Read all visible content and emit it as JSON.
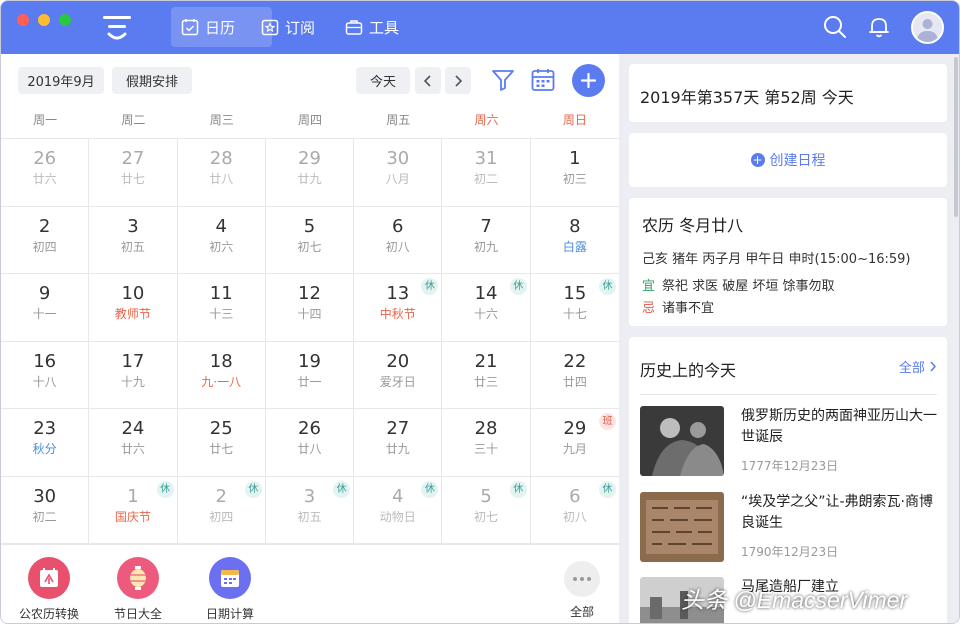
{
  "topbar": {
    "nav": [
      {
        "label": "日历",
        "icon": "calendar-check-icon",
        "active": true
      },
      {
        "label": "订阅",
        "icon": "star-card-icon",
        "active": false
      },
      {
        "label": "工具",
        "icon": "briefcase-icon",
        "active": false
      }
    ],
    "accent": "#5b7cf0"
  },
  "calendar": {
    "month_label": "2019年9月",
    "holiday_label": "假期安排",
    "today_label": "今天",
    "weekdays": [
      "周一",
      "周二",
      "周三",
      "周四",
      "周五",
      "周六",
      "周日"
    ],
    "weeks": [
      [
        {
          "day": "26",
          "sub": "廿六",
          "dim": true
        },
        {
          "day": "27",
          "sub": "廿七",
          "dim": true
        },
        {
          "day": "28",
          "sub": "廿八",
          "dim": true
        },
        {
          "day": "29",
          "sub": "廿九",
          "dim": true
        },
        {
          "day": "30",
          "sub": "八月",
          "dim": true
        },
        {
          "day": "31",
          "sub": "初二",
          "dim": true
        },
        {
          "day": "1",
          "sub": "初三"
        }
      ],
      [
        {
          "day": "2",
          "sub": "初四"
        },
        {
          "day": "3",
          "sub": "初五"
        },
        {
          "day": "4",
          "sub": "初六"
        },
        {
          "day": "5",
          "sub": "初七"
        },
        {
          "day": "6",
          "sub": "初八"
        },
        {
          "day": "7",
          "sub": "初九"
        },
        {
          "day": "8",
          "sub": "白露",
          "tone": "blue"
        }
      ],
      [
        {
          "day": "9",
          "sub": "十一"
        },
        {
          "day": "10",
          "sub": "教师节",
          "tone": "orange"
        },
        {
          "day": "11",
          "sub": "十三"
        },
        {
          "day": "12",
          "sub": "十四"
        },
        {
          "day": "13",
          "sub": "中秋节",
          "tone": "orange",
          "badge": "休"
        },
        {
          "day": "14",
          "sub": "十六",
          "badge": "休"
        },
        {
          "day": "15",
          "sub": "十七",
          "badge": "休"
        }
      ],
      [
        {
          "day": "16",
          "sub": "十八"
        },
        {
          "day": "17",
          "sub": "十九"
        },
        {
          "day": "18",
          "sub": "九·一八",
          "tone": "orange"
        },
        {
          "day": "19",
          "sub": "廿一"
        },
        {
          "day": "20",
          "sub": "爱牙日"
        },
        {
          "day": "21",
          "sub": "廿三"
        },
        {
          "day": "22",
          "sub": "廿四"
        }
      ],
      [
        {
          "day": "23",
          "sub": "秋分",
          "tone": "blue"
        },
        {
          "day": "24",
          "sub": "廿六"
        },
        {
          "day": "25",
          "sub": "廿七"
        },
        {
          "day": "26",
          "sub": "廿八"
        },
        {
          "day": "27",
          "sub": "廿九"
        },
        {
          "day": "28",
          "sub": "三十"
        },
        {
          "day": "29",
          "sub": "九月",
          "badge": "班"
        }
      ],
      [
        {
          "day": "30",
          "sub": "初二"
        },
        {
          "day": "1",
          "sub": "国庆节",
          "tone": "orange",
          "badge": "休",
          "dim": true
        },
        {
          "day": "2",
          "sub": "初四",
          "badge": "休",
          "dim": true
        },
        {
          "day": "3",
          "sub": "初五",
          "badge": "休",
          "dim": true
        },
        {
          "day": "4",
          "sub": "动物日",
          "badge": "休",
          "dim": true
        },
        {
          "day": "5",
          "sub": "初七",
          "badge": "休",
          "dim": true
        },
        {
          "day": "6",
          "sub": "初八",
          "badge": "休",
          "dim": true
        }
      ]
    ]
  },
  "tools": [
    {
      "label": "公农历转换",
      "icon": "nong-convert-icon",
      "color": "#e8506e"
    },
    {
      "label": "节日大全",
      "icon": "lantern-icon",
      "color": "#ec5b7d"
    },
    {
      "label": "日期计算",
      "icon": "date-calc-icon",
      "color": "#6b6ff0"
    },
    {
      "label": "全部",
      "icon": "more-dots-icon",
      "color": "#eeeeee"
    }
  ],
  "right": {
    "today_info": "2019年第357天 第52周 今天",
    "create_label": "创建日程",
    "lunar_title": "农历 冬月廿八",
    "ganzhi": "己亥 猪年 丙子月 甲午日 申时(15:00~16:59)",
    "yi_key": "宜",
    "yi_val": "祭祀 求医 破屋 坏垣 馀事勿取",
    "ji_key": "忌",
    "ji_val": "诸事不宜",
    "history_title": "历史上的今天",
    "history_all": "全部",
    "history": [
      {
        "title": "俄罗斯历史的两面神亚历山大一世诞辰",
        "date": "1777年12月23日"
      },
      {
        "title": "“埃及学之父”让-弗朗索瓦·商博良诞生",
        "date": "1790年12月23日"
      },
      {
        "title": "马尾造船厂建立",
        "date": ""
      }
    ]
  },
  "watermark": "头条 @EmacserVimer"
}
